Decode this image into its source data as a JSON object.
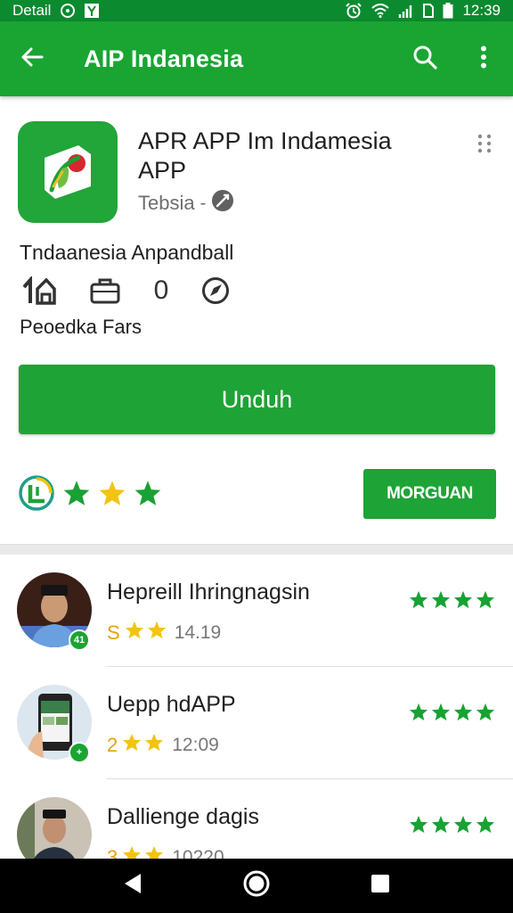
{
  "status_bar": {
    "left_text": "Detail",
    "time": "12:39",
    "colors": {
      "background": "#0b8a2f"
    }
  },
  "app_bar": {
    "title": "AIP Indanesia",
    "back_icon": "arrow-back-icon",
    "search_icon": "search-icon",
    "menu_icon": "more-vertical-icon",
    "color": "#1aa532"
  },
  "app": {
    "name": "APR APP Im Indamesia APP",
    "developer": "Tebsia",
    "tagline": "Tndaanesia Anpandball",
    "meta_count": "0",
    "content_rating": "Peoedka Fars",
    "icon_name": "leaf-app-icon"
  },
  "install_button": {
    "label": "Unduh"
  },
  "secondary_button": {
    "label": "MORGUAN"
  },
  "reviews": [
    {
      "title": "Hepreill Ihringnagsin",
      "rate": "S",
      "date": "14.19",
      "badge": "41"
    },
    {
      "title": "Uepp hdAPP",
      "rate": "2",
      "date": "12:09",
      "badge": "+"
    },
    {
      "title": "Dallienge dagis",
      "rate": "3",
      "date": "10220",
      "badge": ""
    }
  ],
  "colors": {
    "primary": "#1aa532",
    "star_green": "#18a233",
    "star_yellow": "#f2c40f"
  }
}
